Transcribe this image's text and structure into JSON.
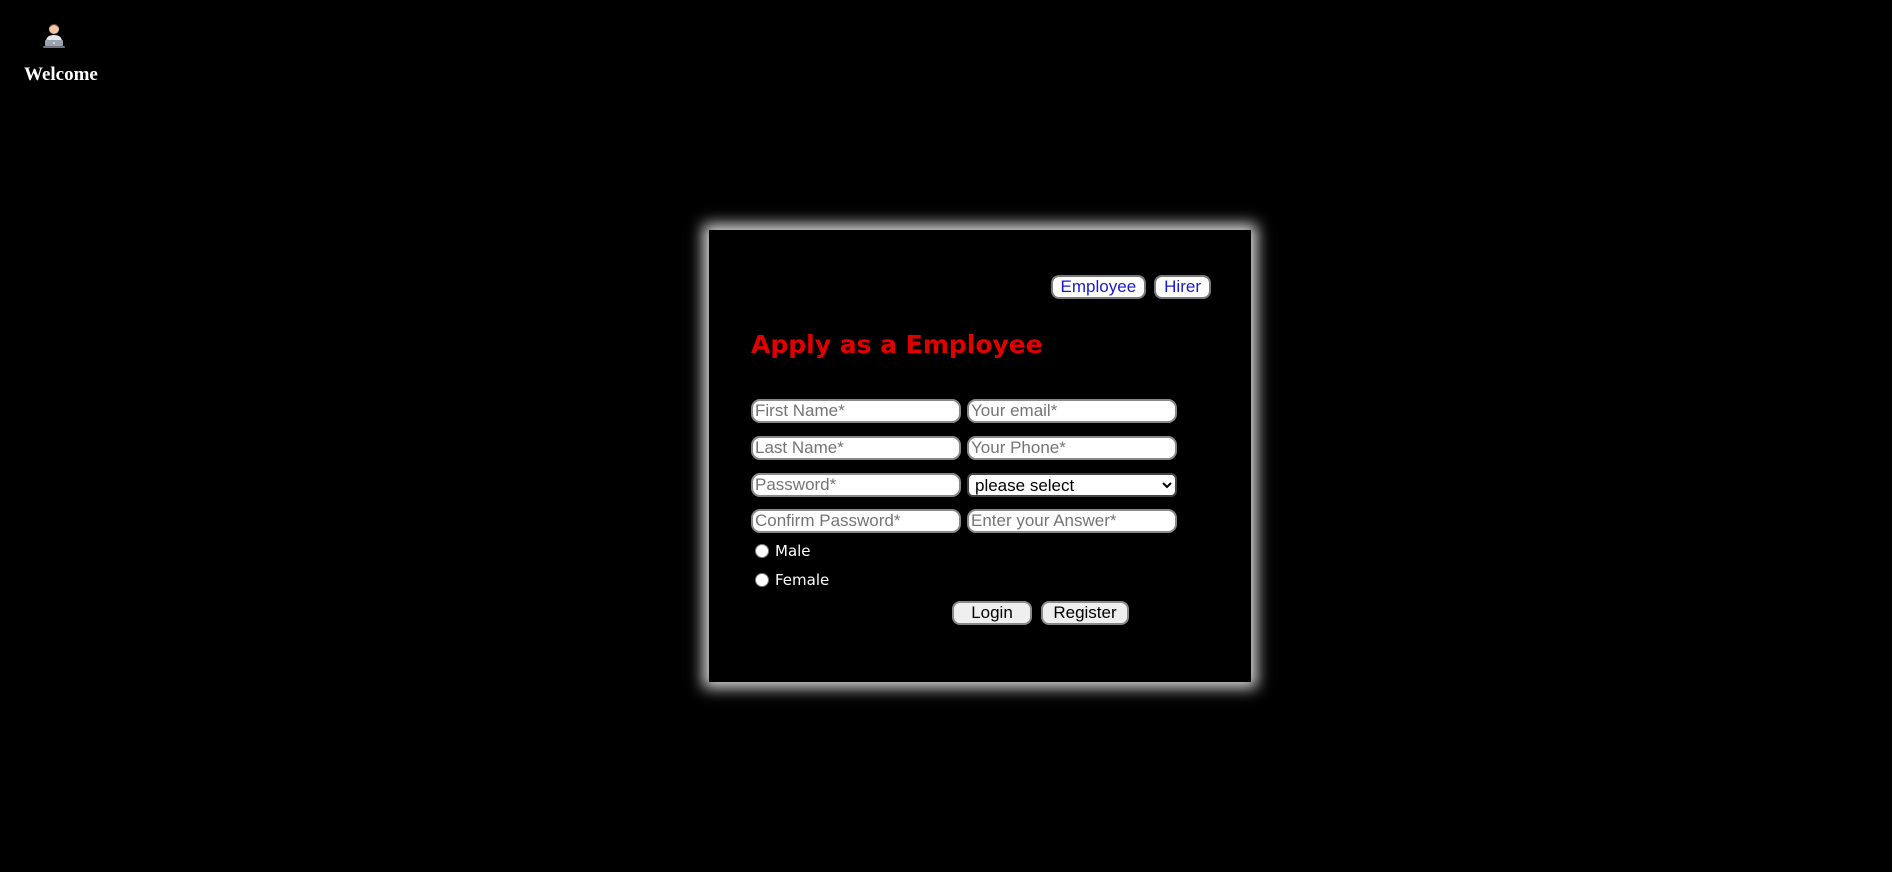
{
  "brand": {
    "icon": "person-at-laptop-icon",
    "welcome_text": "Welcome"
  },
  "role_tabs": {
    "employee_label": "Employee",
    "hirer_label": "Hirer"
  },
  "form": {
    "title": "Apply as a Employee",
    "first_name_placeholder": "First Name*",
    "last_name_placeholder": "Last Name*",
    "password_placeholder": "Password*",
    "confirm_password_placeholder": "Confirm Password*",
    "email_placeholder": "Your email*",
    "phone_placeholder": "Your Phone*",
    "question_select_value": "please select",
    "answer_placeholder": "Enter your Answer*",
    "gender_options": [
      "Male",
      "Female"
    ],
    "login_label": "Login",
    "register_label": "Register"
  },
  "colors": {
    "background": "#000000",
    "title": "#e00000",
    "tab_text": "#1a1ad1"
  }
}
